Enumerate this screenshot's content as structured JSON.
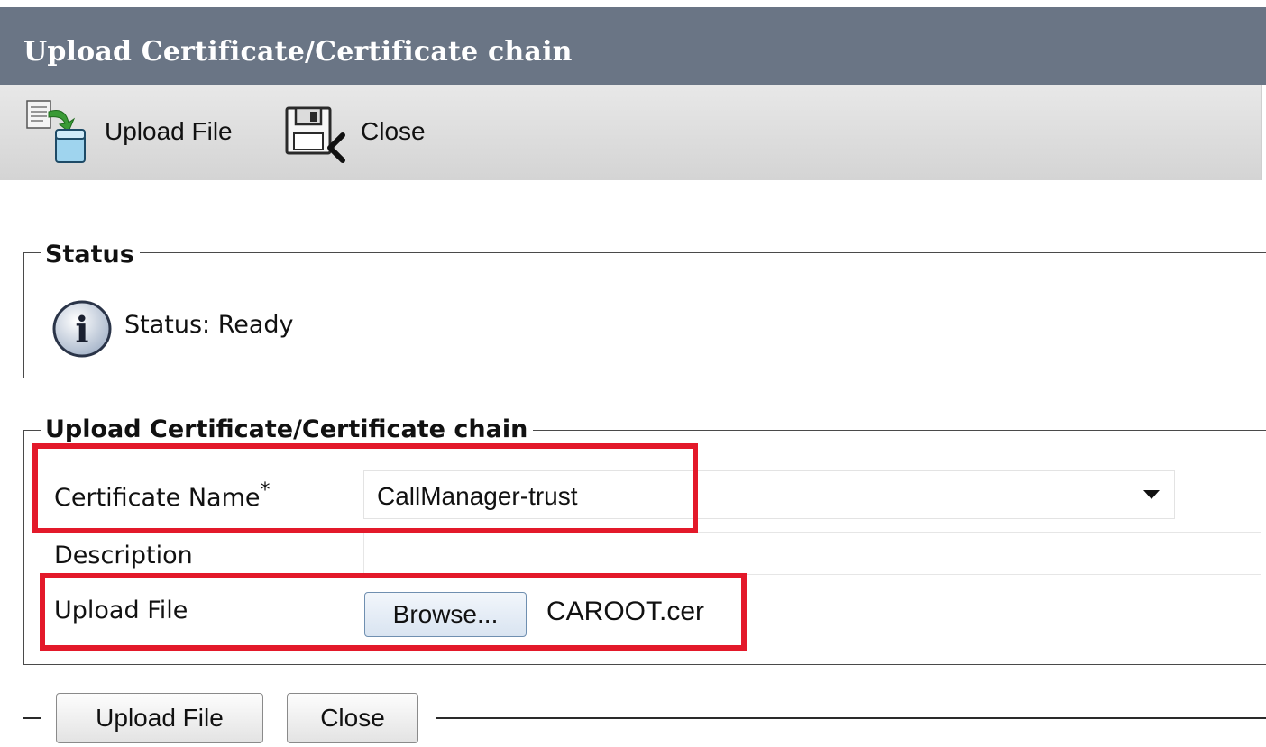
{
  "header": {
    "title": "Upload Certificate/Certificate chain"
  },
  "toolbar": {
    "upload_label": "Upload File",
    "close_label": "Close"
  },
  "status_section": {
    "legend": "Status",
    "message": "Status: Ready"
  },
  "upload_section": {
    "legend": "Upload Certificate/Certificate chain",
    "certificate_name_label": "Certificate Name",
    "required_marker": "*",
    "certificate_name_value": "CallManager-trust",
    "description_label": "Description",
    "description_value": "",
    "upload_file_label": "Upload File",
    "browse_label": "Browse...",
    "selected_file": "CAROOT.cer"
  },
  "footer": {
    "upload_label": "Upload File",
    "close_label": "Close"
  },
  "colors": {
    "title_bar": "#6a7585",
    "highlight": "#e3192a",
    "toolbar": "#dcdcdc"
  },
  "icons": [
    "upload-file-icon",
    "close-save-icon",
    "info-icon",
    "dropdown-arrow-icon"
  ]
}
